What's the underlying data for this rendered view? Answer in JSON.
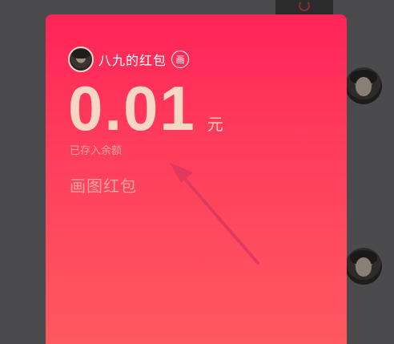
{
  "red_packet": {
    "sender_name": "八九的红包",
    "draw_badge": "画",
    "amount": "0.01",
    "unit": "元",
    "saved_note": "已存入余额",
    "packet_type": "画图红包"
  },
  "colors": {
    "packet_top": "#ff2456",
    "packet_bottom": "#ff5a60",
    "amount_text": "#f6d6c4",
    "secondary_text": "#f2a39f",
    "background": "#4b4b4d"
  },
  "icons": [
    "draw-icon",
    "user-avatar",
    "annotation-arrow"
  ]
}
